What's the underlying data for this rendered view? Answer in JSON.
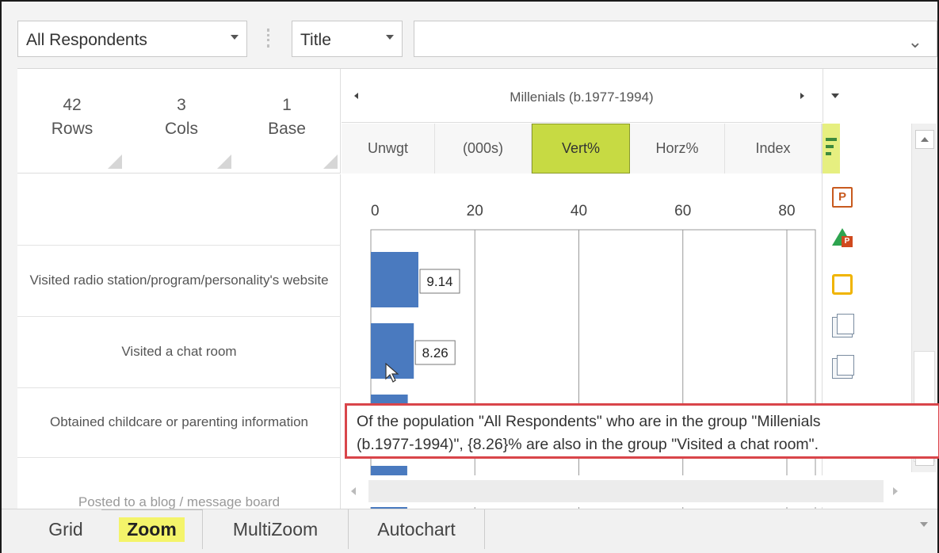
{
  "toolbar": {
    "population_select": "All Respondents",
    "label_select": "Title",
    "expand_icon": "chevron-down-icon"
  },
  "summary": {
    "rows": {
      "value": "42",
      "label": "Rows"
    },
    "cols": {
      "value": "3",
      "label": "Cols"
    },
    "base": {
      "value": "1",
      "label": "Base"
    }
  },
  "column_group": {
    "title": "Millenials (b.1977-1994)"
  },
  "measure_tabs": [
    "Unwgt",
    "(000s)",
    "Vert%",
    "Horz%",
    "Index"
  ],
  "active_measure": "Vert%",
  "row_labels": [
    "Visited radio station/program/personality's website",
    "Visited a chat room",
    "Obtained childcare or parenting information",
    "Posted to a blog / message board"
  ],
  "chart_data": {
    "type": "bar",
    "orientation": "horizontal",
    "categories": [
      "Visited radio station/program/personality's website",
      "Visited a chat room",
      "Obtained childcare or parenting information",
      "Posted to a blog / message board"
    ],
    "values": [
      9.14,
      8.26,
      7.1,
      7.0
    ],
    "data_labels": [
      "9.14",
      "8.26"
    ],
    "axis_ticks": [
      "0",
      "20",
      "40",
      "60",
      "80"
    ],
    "xlim": [
      0,
      90
    ],
    "bar_color": "#4a7abf",
    "grid": true
  },
  "tooltip": {
    "line1": "Of the population \"All Respondents\" who are in the group \"Millenials",
    "line2": "(b.1977-1994)\", {8.26}% are also in the group \"Visited a chat room\"."
  },
  "side_tools": [
    "powerpoint-icon",
    "google-drive-powerpoint-icon",
    "google-slides-icon",
    "copy-icon",
    "paste-icon"
  ],
  "bottom_tabs": [
    "Grid",
    "Zoom",
    "MultiZoom",
    "Autochart"
  ],
  "active_bottom_tab": "Zoom",
  "colors": {
    "highlight": "#c7da43",
    "tooltip_border": "#d9454a",
    "bar": "#4a7abf"
  }
}
